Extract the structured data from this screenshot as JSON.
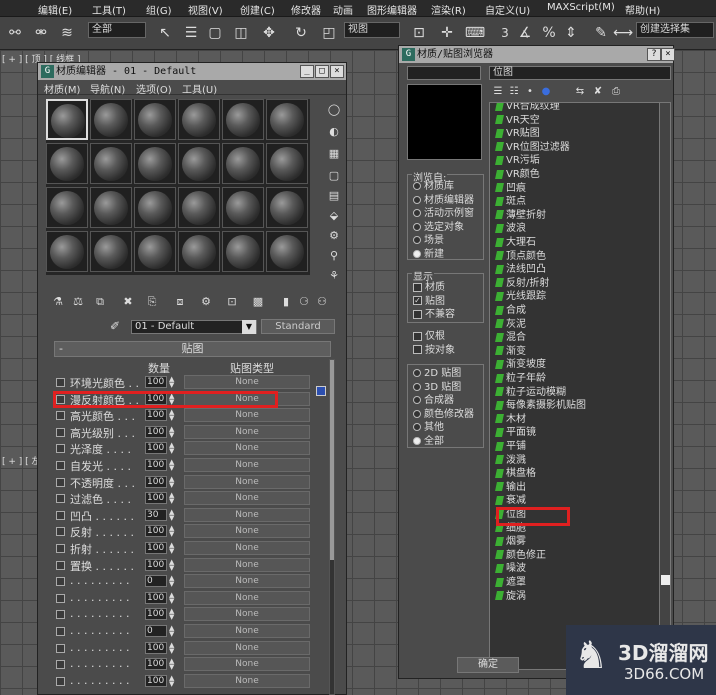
{
  "menubar": {
    "items": [
      "编辑(E)",
      "工具(T)",
      "组(G)",
      "视图(V)",
      "创建(C)",
      "修改器",
      "动画",
      "图形编辑器",
      "渲染(R)",
      "自定义(U)",
      "MAXScript(M)",
      "帮助(H)"
    ]
  },
  "toolbar": {
    "filter": "全部",
    "view": "视图",
    "selection_set": "创建选择集",
    "num3": "3"
  },
  "viewport": {
    "label_top": "[ + ] [ 顶 ] [ 线框 ]",
    "label_left": "[ + ] [ 左 ]"
  },
  "material_editor": {
    "title": "材质编辑器 - 01 - Default",
    "menu": [
      "材质(M)",
      "导航(N)",
      "选项(O)",
      "工具(U)"
    ],
    "material_name": "01 - Default",
    "material_type": "Standard",
    "rollout_sign": "-",
    "rollout_title": "贴图",
    "col_amount": "数量",
    "col_maptype": "贴图类型",
    "maps": [
      {
        "label": "环境光颜色 . .",
        "value": "100",
        "map": "None"
      },
      {
        "label": "漫反射颜色 . .",
        "value": "100",
        "map": "None"
      },
      {
        "label": "高光颜色 . . .",
        "value": "100",
        "map": "None"
      },
      {
        "label": "高光级别 . . .",
        "value": "100",
        "map": "None"
      },
      {
        "label": "光泽度 . . . .",
        "value": "100",
        "map": "None"
      },
      {
        "label": "自发光 . . . .",
        "value": "100",
        "map": "None"
      },
      {
        "label": "不透明度 . . .",
        "value": "100",
        "map": "None"
      },
      {
        "label": "过滤色 . . . .",
        "value": "100",
        "map": "None"
      },
      {
        "label": "凹凸 . . . . . .",
        "value": "30",
        "map": "None"
      },
      {
        "label": "反射 . . . . . .",
        "value": "100",
        "map": "None"
      },
      {
        "label": "折射 . . . . . .",
        "value": "100",
        "map": "None"
      },
      {
        "label": "置换 . . . . . .",
        "value": "100",
        "map": "None"
      },
      {
        "label": ". . . . . . . . .",
        "value": "0",
        "map": "None"
      },
      {
        "label": ". . . . . . . . .",
        "value": "100",
        "map": "None"
      },
      {
        "label": ". . . . . . . . .",
        "value": "100",
        "map": "None"
      },
      {
        "label": ". . . . . . . . .",
        "value": "0",
        "map": "None"
      },
      {
        "label": ". . . . . . . . .",
        "value": "100",
        "map": "None"
      },
      {
        "label": ". . . . . . . . .",
        "value": "100",
        "map": "None"
      },
      {
        "label": ". . . . . . . . .",
        "value": "100",
        "map": "None"
      }
    ]
  },
  "map_browser": {
    "title": "材质/贴图浏览器",
    "name_field": "位图",
    "browse_from_title": "浏览自:",
    "browse_from": [
      {
        "label": "材质库",
        "on": false
      },
      {
        "label": "材质编辑器",
        "on": false
      },
      {
        "label": "活动示例窗",
        "on": false
      },
      {
        "label": "选定对象",
        "on": false
      },
      {
        "label": "场景",
        "on": false
      },
      {
        "label": "新建",
        "on": true
      }
    ],
    "show_title": "显示",
    "show": [
      {
        "label": "材质",
        "checked": false
      },
      {
        "label": "贴图",
        "checked": true
      },
      {
        "label": "不兼容",
        "checked": false
      }
    ],
    "extra": [
      {
        "label": "仅根",
        "checked": false
      },
      {
        "label": "按对象",
        "checked": false
      }
    ],
    "categories": [
      {
        "label": "2D 贴图",
        "on": false
      },
      {
        "label": "3D 贴图",
        "on": false
      },
      {
        "label": "合成器",
        "on": false
      },
      {
        "label": "颜色修改器",
        "on": false
      },
      {
        "label": "其他",
        "on": false
      },
      {
        "label": "全部",
        "on": true
      }
    ],
    "maps": [
      "VR合成纹理",
      "VR天空",
      "VR贴图",
      "VR位图过滤器",
      "VR污垢",
      "VR颜色",
      "凹痕",
      "斑点",
      "薄壁折射",
      "波浪",
      "大理石",
      "顶点颜色",
      "法线凹凸",
      "反射/折射",
      "光线跟踪",
      "合成",
      "灰泥",
      "混合",
      "渐变",
      "渐变坡度",
      "粒子年龄",
      "粒子运动模糊",
      "每像素摄影机贴图",
      "木材",
      "平面镜",
      "平铺",
      "泼溅",
      "棋盘格",
      "输出",
      "衰减",
      "位图",
      "细胞",
      "烟雾",
      "颜色修正",
      "噪波",
      "遮罩",
      "旋涡"
    ],
    "ok": "确定"
  },
  "logo": {
    "cn": "3D溜溜网",
    "en": "3D66.COM"
  }
}
